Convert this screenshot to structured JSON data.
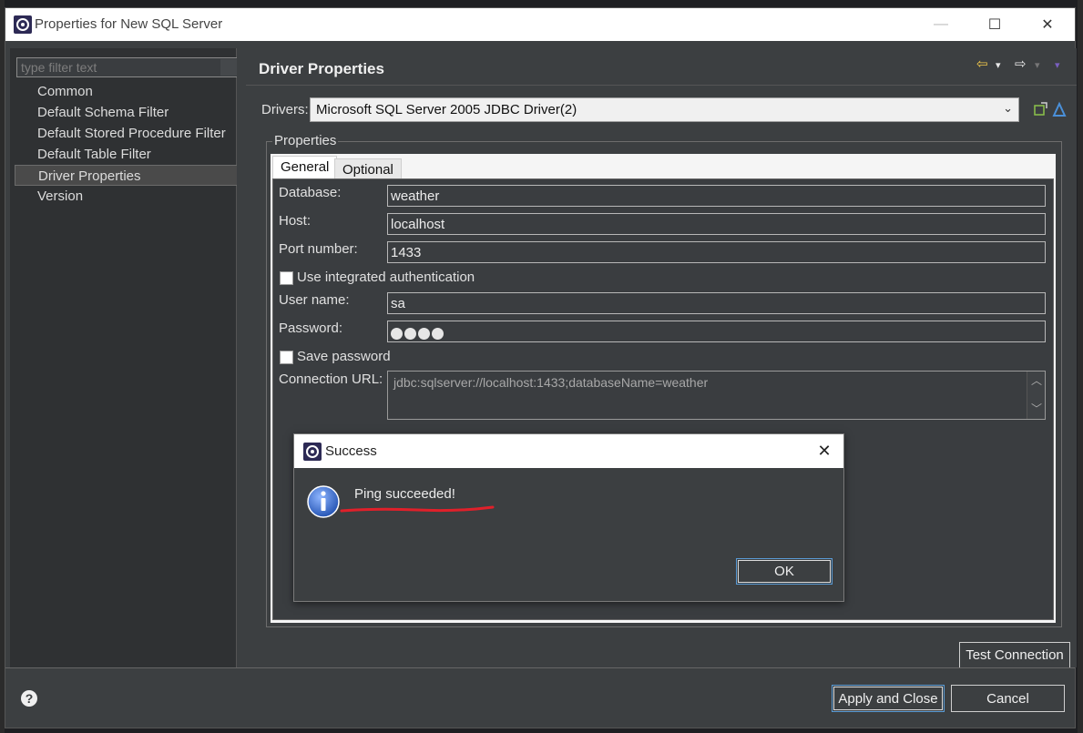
{
  "window": {
    "title": "Properties for New SQL Server",
    "minimize_glyph": "—",
    "maximize_glyph": "☐",
    "close_glyph": "✕"
  },
  "filter": {
    "placeholder": "type filter text"
  },
  "tree": {
    "items": [
      {
        "label": "Common",
        "selected": false
      },
      {
        "label": "Default Schema Filter",
        "selected": false
      },
      {
        "label": "Default Stored Procedure Filter",
        "selected": false
      },
      {
        "label": "Default Table Filter",
        "selected": false
      },
      {
        "label": "Driver Properties",
        "selected": true
      },
      {
        "label": "Version",
        "selected": false
      }
    ]
  },
  "page": {
    "title": "Driver Properties",
    "nav": {
      "back_glyph": "⇦",
      "forward_glyph": "⇨",
      "dropdown_glyph": "▾"
    }
  },
  "drivers": {
    "label": "Drivers:",
    "value": "Microsoft SQL Server 2005 JDBC Driver(2)",
    "arrow_glyph": "⌄"
  },
  "properties": {
    "legend": "Properties",
    "tabs": [
      {
        "label": "General"
      },
      {
        "label": "Optional"
      }
    ],
    "database": {
      "label": "Database:",
      "value": "weather"
    },
    "host": {
      "label": "Host:",
      "value": "localhost"
    },
    "port": {
      "label": "Port number:",
      "value": "1433"
    },
    "integrated_auth": {
      "label": "Use integrated authentication",
      "checked": false
    },
    "user": {
      "label": "User name:",
      "value": "sa"
    },
    "password": {
      "label": "Password:",
      "masked_length": 4
    },
    "save_password": {
      "label": "Save password",
      "checked": false
    },
    "url": {
      "label": "Connection URL:",
      "value": "jdbc:sqlserver://localhost:1433;databaseName=weather",
      "scroll_up_glyph": "︿",
      "scroll_down_glyph": "﹀"
    }
  },
  "buttons": {
    "test_connection": "Test Connection",
    "apply_and_close": "Apply and Close",
    "cancel": "Cancel",
    "help_glyph": "?"
  },
  "popup": {
    "title": "Success",
    "message": "Ping succeeded!",
    "ok": "OK",
    "close_glyph": "✕"
  },
  "colors": {
    "accent_red": "#e0202a",
    "info_blue": "#2a62c8",
    "default_button_border": "#5a9bd5"
  }
}
